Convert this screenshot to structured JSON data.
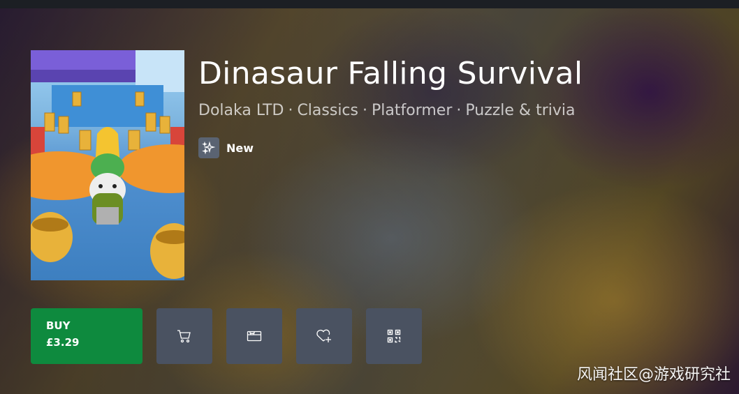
{
  "product": {
    "title": "Dinasaur Falling Survival",
    "publisher": "Dolaka LTD",
    "separator": "·",
    "categories": [
      "Classics",
      "Platformer",
      "Puzzle & trivia"
    ],
    "badge": {
      "icon": "sparkle-icon",
      "label": "New"
    }
  },
  "actions": {
    "buy": {
      "label": "BUY",
      "price": "£3.29",
      "color": "#0e8a3e"
    },
    "icon_buttons": [
      {
        "name": "add-to-cart-button",
        "icon": "cart-icon"
      },
      {
        "name": "gift-button",
        "icon": "gift-card-icon"
      },
      {
        "name": "wishlist-button",
        "icon": "heart-plus-icon"
      },
      {
        "name": "qr-code-button",
        "icon": "qr-code-icon"
      }
    ]
  },
  "watermark": {
    "text": "风闻社区@游戏研究社"
  },
  "colors": {
    "button_gray": "#4a5261",
    "buy_green": "#0e8a3e"
  }
}
